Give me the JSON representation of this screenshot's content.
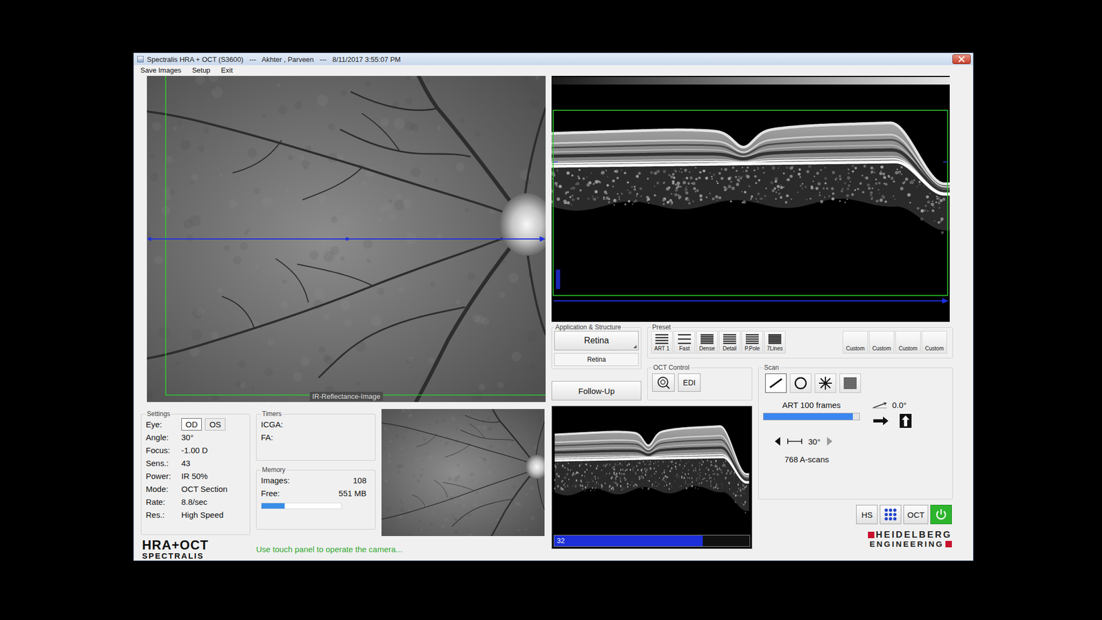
{
  "window": {
    "title": "Spectralis HRA + OCT (S3600)   ---   Akhter , Parveen   ---   8/11/2017 3:55:07 PM"
  },
  "menu": [
    {
      "label": "Save Images"
    },
    {
      "label": "Setup"
    },
    {
      "label": "Exit"
    }
  ],
  "ir_image": {
    "label": "IR-Reflectance-Image"
  },
  "settings": {
    "title": "Settings",
    "eye": {
      "label": "Eye:",
      "options": [
        {
          "label": "OD",
          "selected": true
        },
        {
          "label": "OS",
          "selected": false
        }
      ]
    },
    "rows": [
      {
        "label": "Angle:",
        "value": "30°"
      },
      {
        "label": "Focus:",
        "value": "-1.00 D"
      },
      {
        "label": "Sens.:",
        "value": "43"
      },
      {
        "label": "Power:",
        "value": "IR  50%"
      },
      {
        "label": "Mode:",
        "value": "OCT Section"
      },
      {
        "label": "Rate:",
        "value": "8.8/sec"
      },
      {
        "label": "Res.:",
        "value": "High Speed"
      }
    ]
  },
  "timers": {
    "title": "Timers",
    "rows": [
      {
        "label": "ICGA:"
      },
      {
        "label": "FA:"
      }
    ]
  },
  "memory": {
    "title": "Memory",
    "rows": [
      {
        "label": "Images:",
        "value": "108"
      },
      {
        "label": "Free:",
        "value": "551 MB"
      }
    ],
    "level": 0.29
  },
  "application": {
    "title": "Application & Structure",
    "application": "Retina",
    "structure": "Retina",
    "follow_up": "Follow-Up"
  },
  "preset": {
    "title": "Preset",
    "buttons": [
      {
        "label": "ART 1",
        "kind": "preset"
      },
      {
        "label": "Fast",
        "kind": "preset"
      },
      {
        "label": "Dense",
        "kind": "preset"
      },
      {
        "label": "Detail",
        "kind": "preset"
      },
      {
        "label": "P.Pole",
        "kind": "preset"
      },
      {
        "label": "7Lines",
        "kind": "preset"
      },
      {
        "label": "Custom",
        "kind": "custom"
      },
      {
        "label": "Custom",
        "kind": "custom"
      },
      {
        "label": "Custom",
        "kind": "custom"
      },
      {
        "label": "Custom",
        "kind": "custom"
      }
    ]
  },
  "oct_control": {
    "title": "OCT Control",
    "edi": "EDI"
  },
  "scan": {
    "title": "Scan",
    "patterns": [
      {
        "kind": "line",
        "selected": true
      },
      {
        "kind": "circle",
        "selected": false
      },
      {
        "kind": "star",
        "selected": false
      },
      {
        "kind": "raster",
        "selected": false
      }
    ],
    "art": {
      "label": "ART 100 frames",
      "level": 0.93
    },
    "angle": "0.0°",
    "size": "30°",
    "ascans": "768 A-scans"
  },
  "live_oct": {
    "frames": "32",
    "level": 0.76
  },
  "footer": {
    "logo": {
      "line1": "HRA+OCT",
      "line2": "SPECTRALIS"
    },
    "status": "Use touch panel to operate the camera...",
    "buttons": [
      {
        "kind": "text",
        "label": "HS"
      },
      {
        "kind": "grid"
      },
      {
        "kind": "text",
        "label": "OCT"
      },
      {
        "kind": "power"
      }
    ],
    "brand": {
      "line1": "HEIDELBERG",
      "line2": "ENGINEERING"
    }
  }
}
